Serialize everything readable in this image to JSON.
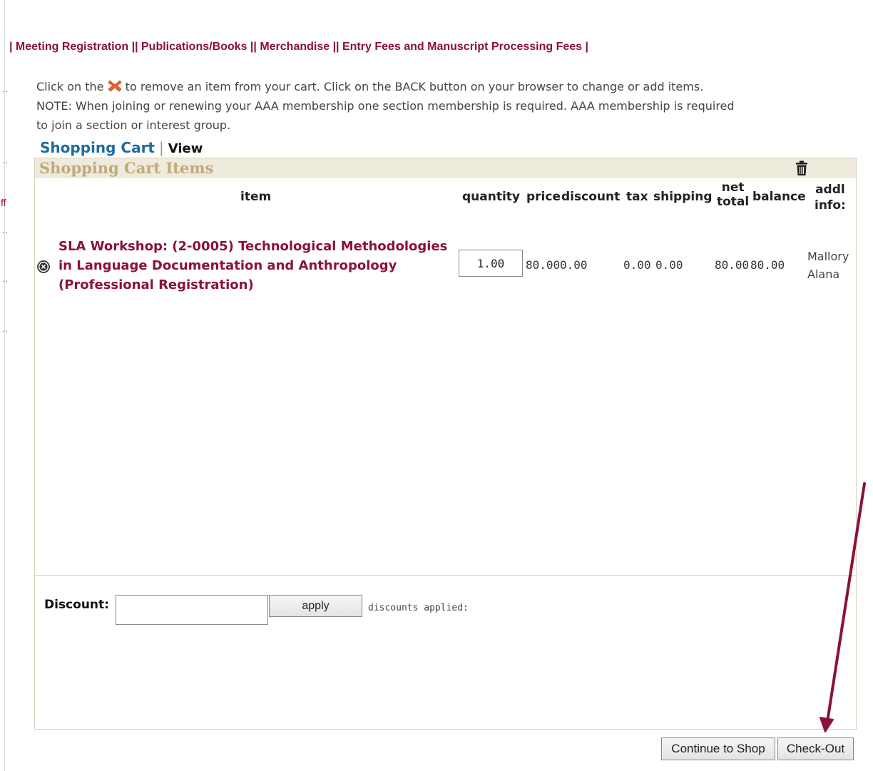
{
  "nav": {
    "items": [
      "Meeting Registration",
      "Publications/Books",
      "Merchandise",
      "Entry Fees and Manuscript Processing Fees"
    ]
  },
  "left_edge": {
    "ff": "ff"
  },
  "instructions": {
    "pre": "Click on the",
    "post": "to remove an item from your cart. Click on the BACK button on your browser to change or add items. NOTE: When joining or renewing your AAA membership one section membership is required. AAA membership is required to join a section or interest group."
  },
  "cart": {
    "title": "Shopping Cart",
    "separator": "|",
    "view": "View",
    "panel_title": "Shopping Cart Items"
  },
  "table": {
    "headers": {
      "item": "item",
      "quantity": "quantity",
      "price": "price",
      "discount": "discount",
      "tax": "tax",
      "shipping": "shipping",
      "net_top": "net",
      "net_bottom": "total",
      "balance": "balance",
      "addl_top": "addl",
      "addl_bottom": "info:"
    },
    "row": {
      "item_line1": "SLA Workshop: (2-0005) Technological Methodologies",
      "item_line2": "in Language Documentation and Anthropology",
      "item_line3": "(Professional Registration)",
      "quantity": "1.00",
      "price": "80.00",
      "discount": "0.00",
      "tax": "0.00",
      "shipping": "0.00",
      "net_total": "80.00",
      "balance": "80.00",
      "addl_line1": "Mallory",
      "addl_line2": "Alana"
    }
  },
  "discount": {
    "label": "Discount:",
    "value": "",
    "apply_label": "apply",
    "applied_label": "discounts applied:"
  },
  "buttons": {
    "continue": "Continue to Shop",
    "checkout": "Check-Out"
  },
  "colors": {
    "nav": "#8b1237",
    "item_link": "#8b1237",
    "cart_title": "#1f6c9c",
    "panel_head_bg": "#eeeadc",
    "panel_head_text": "#c0aa7a",
    "annotation_arrow": "#8b1237"
  }
}
